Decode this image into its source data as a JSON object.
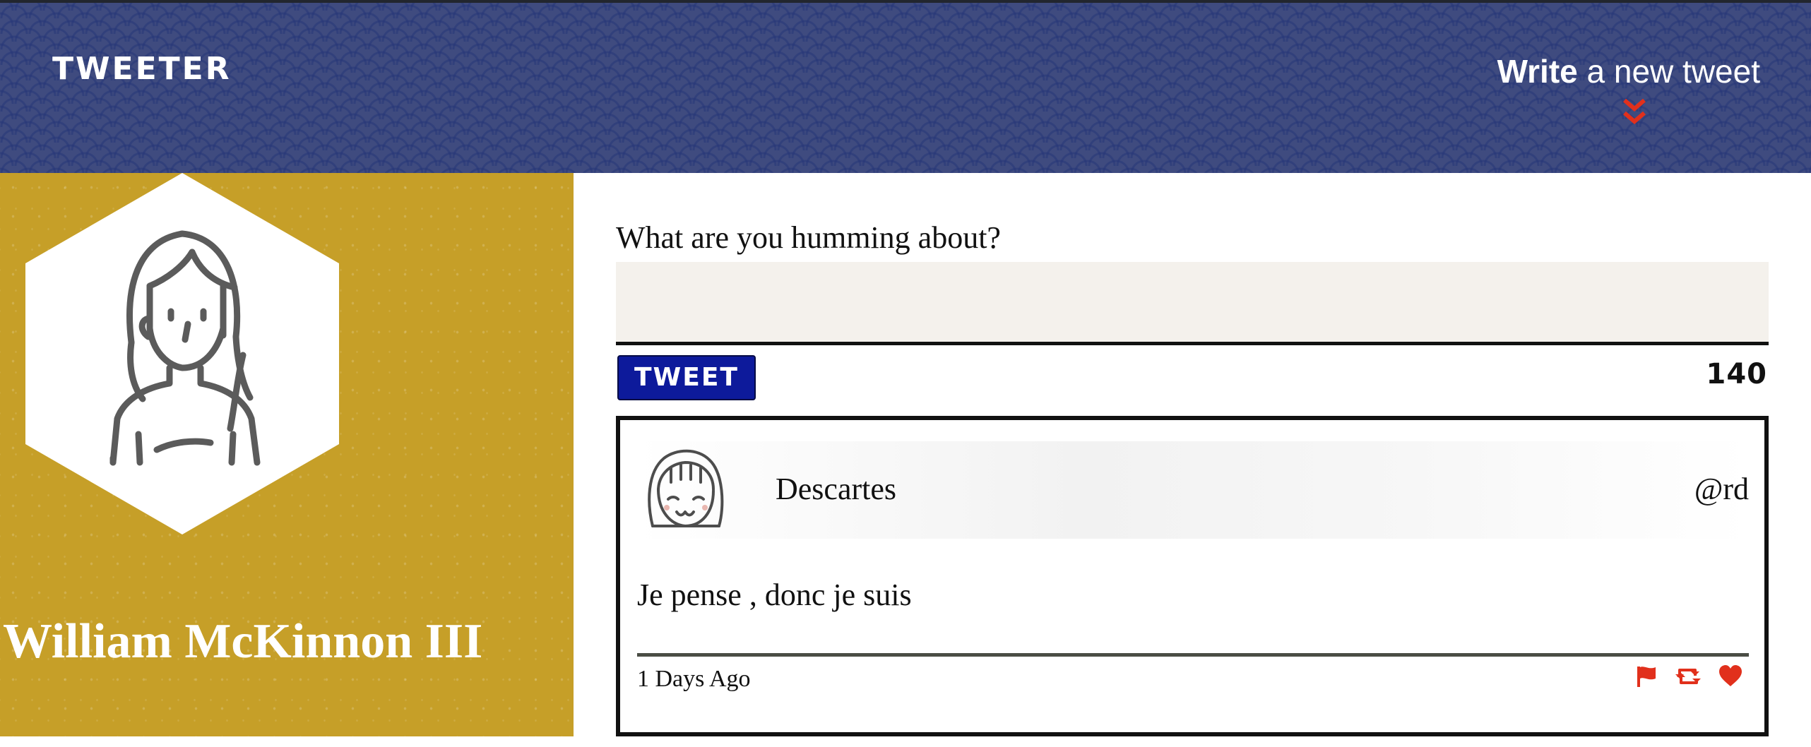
{
  "nav": {
    "brand": "TWEETER",
    "compose_strong": "Write",
    "compose_rest": " a new tweet",
    "chevron_icon": "double-chevron-down-icon"
  },
  "profile": {
    "name": "William McKinnon III",
    "avatar_icon": "user-avatar-icon"
  },
  "composer": {
    "label": "What are you humming about?",
    "input_value": "",
    "button_label": "TWEET",
    "counter": "140"
  },
  "tweets": [
    {
      "author": "Descartes",
      "handle": "@rd",
      "body": "Je pense , donc je suis",
      "time": "1 Days Ago",
      "avatar_icon": "user-avatar-icon",
      "actions": [
        "flag-icon",
        "retweet-icon",
        "heart-icon"
      ]
    }
  ],
  "colors": {
    "nav_bg": "#3f4b7f",
    "profile_bg": "#c69f28",
    "button_bg": "#0d1a9b",
    "accent_red": "#e1301c",
    "composer_bg": "#f4f1ec"
  }
}
